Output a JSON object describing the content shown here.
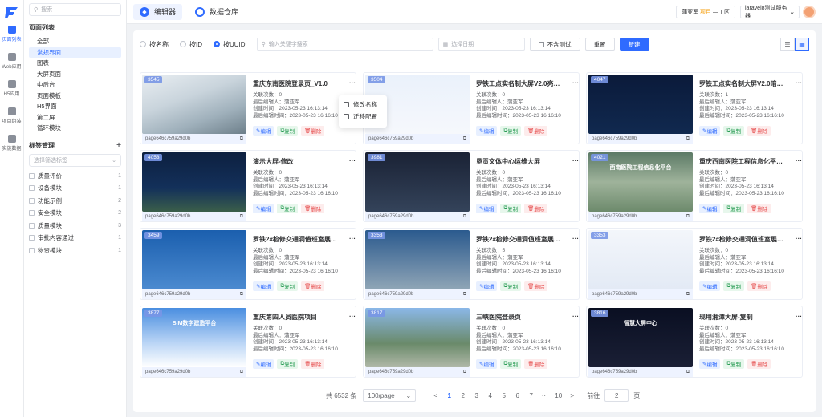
{
  "rail": [
    {
      "label": "页面列表",
      "icon": "page-list-icon",
      "active": true
    },
    {
      "label": "Web应用",
      "icon": "web-app-icon",
      "active": false
    },
    {
      "label": "H5应用",
      "icon": "h5-app-icon",
      "active": false
    },
    {
      "label": "项目组装",
      "icon": "project-assembly-icon",
      "active": false
    },
    {
      "label": "实施数据",
      "icon": "data-icon",
      "active": false
    }
  ],
  "sidebar": {
    "search_placeholder": "搜索",
    "page_list_title": "页面列表",
    "pages": [
      "全部",
      "常规界面",
      "图表",
      "大屏页面",
      "中后台",
      "页面模板",
      "H5界面",
      "第二屏",
      "循环模块"
    ],
    "active_page": 1,
    "tag_title": "标签管理",
    "tag_add": "+",
    "tag_select_placeholder": "选择筛选标签",
    "tags": [
      {
        "name": "质量评价",
        "count": "1"
      },
      {
        "name": "设备模块",
        "count": "1"
      },
      {
        "name": "功能示例",
        "count": "2"
      },
      {
        "name": "安全模块",
        "count": "2"
      },
      {
        "name": "质量模块",
        "count": "3"
      },
      {
        "name": "审批内容通过",
        "count": "1"
      },
      {
        "name": "物资模块",
        "count": "1"
      }
    ]
  },
  "topbar": {
    "tabs": [
      {
        "label": "编辑器",
        "active": true
      },
      {
        "label": "数据仓库",
        "active": false
      }
    ],
    "user_name": "蒲亚军",
    "user_role": "项目",
    "user_site": "—工区",
    "server": "laravel8测试服务器"
  },
  "filter": {
    "radios": [
      "按名称",
      "按ID",
      "按UUID"
    ],
    "selected_radio": 2,
    "keyword_placeholder": "输入关键字搜索",
    "date_placeholder": "选择日期",
    "exclude_test": "不含测试",
    "reset": "重置",
    "create": "新建"
  },
  "popup": {
    "rename": "修改名称",
    "migrate": "迁移配置"
  },
  "labels": {
    "linked": "关联次数：",
    "editor": "最后编辑人：",
    "created": "创建时间：",
    "edited": "最后编辑时间：",
    "edit": "编辑",
    "copy": "复制",
    "delete": "删除",
    "more": "···"
  },
  "cards": [
    {
      "id": "3545",
      "title": "重庆东南医院登录页_V1.0",
      "linked": "0",
      "editor": "蒲亚军",
      "created": "2023-05-23 16:13:14",
      "edited": "2023-05-23 16:16:10",
      "page": "page646c759a29d0b",
      "caption": ""
    },
    {
      "id": "3504",
      "title": "罗铁工点实名制大屏V2.0亮…",
      "linked": "0",
      "editor": "蒲亚军",
      "created": "2023-05-23 16:13:14",
      "edited": "2023-05-23 16:16:10",
      "page": "page646c759a29d0b",
      "caption": ""
    },
    {
      "id": "4047",
      "title": "罗铁工点实名制大屏V2.0暗…",
      "linked": "1",
      "editor": "蒲亚军",
      "created": "2023-05-23 16:13:14",
      "edited": "2023-05-23 16:16:10",
      "page": "page646c759a29d0b",
      "caption": ""
    },
    {
      "id": "4053",
      "title": "演示大屏-修改",
      "linked": "0",
      "editor": "蒲亚军",
      "created": "2023-05-23 16:13:14",
      "edited": "2023-05-23 16:16:10",
      "page": "page646c759a29d0b",
      "caption": ""
    },
    {
      "id": "3981",
      "title": "垦贡文体中心运维大屏",
      "linked": "0",
      "editor": "蒲亚军",
      "created": "2023-05-23 16:13:14",
      "edited": "2023-05-23 16:16:10",
      "page": "page646c759a29d0b",
      "caption": ""
    },
    {
      "id": "4021",
      "title": "重庆西南医院工程信息化平…",
      "linked": "0",
      "editor": "蒲亚军",
      "created": "2023-05-23 16:13:14",
      "edited": "2023-05-23 16:16:10",
      "page": "page646c759a29d0b",
      "caption": "西南医院工程信息化平台"
    },
    {
      "id": "3459",
      "title": "罗铁2#检修交通洞值班室展…",
      "linked": "0",
      "editor": "蒲亚军",
      "created": "2023-05-23 16:13:14",
      "edited": "2023-05-23 16:16:10",
      "page": "page646c759a29d0b",
      "caption": ""
    },
    {
      "id": "3353",
      "title": "罗铁2#检修交通洞值班室展…",
      "linked": "5",
      "editor": "蒲亚军",
      "created": "2023-05-23 16:13:14",
      "edited": "2023-05-23 16:16:10",
      "page": "page646c759a29d0b",
      "caption": ""
    },
    {
      "id": "3353",
      "title": "罗铁2#检修交通洞值班室展…",
      "linked": "0",
      "editor": "蒲亚军",
      "created": "2023-05-23 16:13:14",
      "edited": "2023-05-23 16:16:10",
      "page": "page646c759a29d0b",
      "caption": ""
    },
    {
      "id": "3877",
      "title": "重庆第四人员医院项目",
      "linked": "0",
      "editor": "蒲亚军",
      "created": "2023-05-23 16:13:14",
      "edited": "2023-05-23 16:16:10",
      "page": "page646c759a29d0b",
      "caption": "BIM数字建造平台"
    },
    {
      "id": "3817",
      "title": "三峡医院登录页",
      "linked": "0",
      "editor": "蒲亚军",
      "created": "2023-05-23 16:13:14",
      "edited": "2023-05-23 16:16:10",
      "page": "page646c759a29d0b",
      "caption": ""
    },
    {
      "id": "3816",
      "title": "现用湘潭大屏-复制",
      "linked": "0",
      "editor": "蒲亚军",
      "created": "2023-05-23 16:13:14",
      "edited": "2023-05-23 16:16:10",
      "page": "page646c759a29d0b",
      "caption": "智慧大屏中心"
    }
  ],
  "pager": {
    "total": "共 6532 条",
    "size": "100/page",
    "pages": [
      "<",
      "1",
      "2",
      "3",
      "4",
      "5",
      "6",
      "7",
      "···",
      "10",
      ">"
    ],
    "current": "1",
    "goto_label": "前往",
    "goto_value": "2",
    "page_unit": "页"
  }
}
